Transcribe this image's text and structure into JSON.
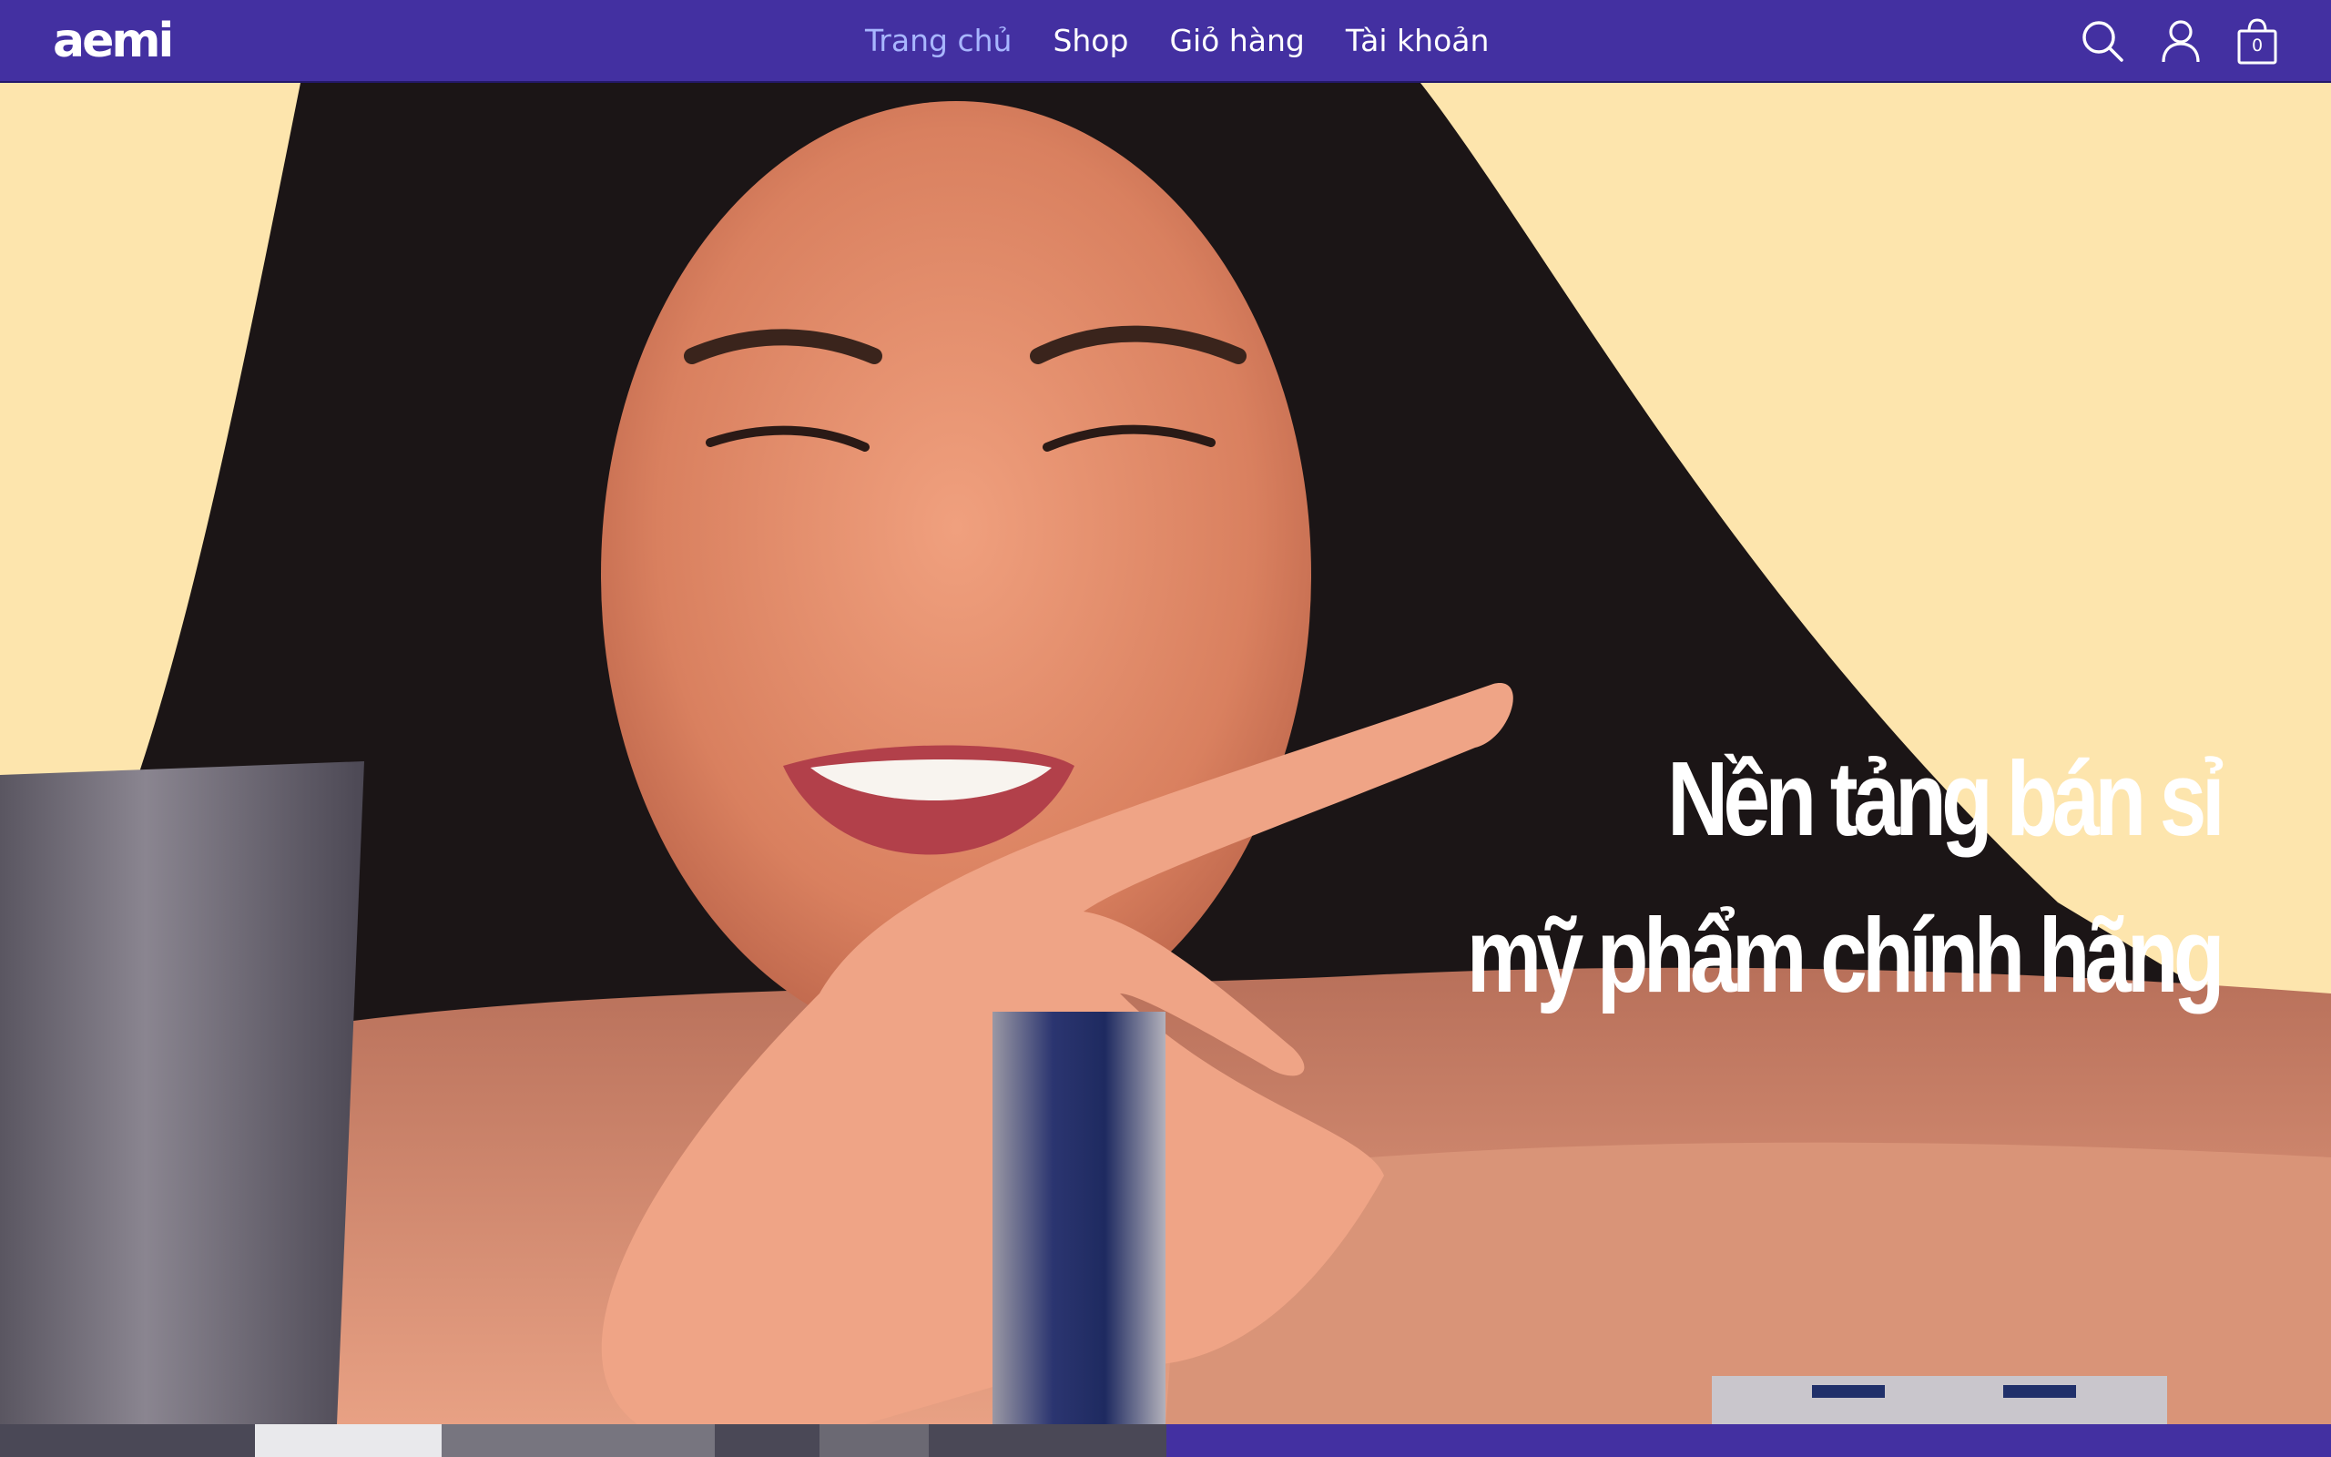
{
  "brand": {
    "logo_text": "aemi"
  },
  "nav": {
    "items": [
      {
        "label": "Trang chủ",
        "active": true
      },
      {
        "label": "Shop",
        "active": false
      },
      {
        "label": "Giỏ hàng",
        "active": false
      },
      {
        "label": "Tài khoản",
        "active": false
      }
    ]
  },
  "header_actions": {
    "search_icon": "search-icon",
    "account_icon": "user-icon",
    "cart_icon": "shopping-bag-icon",
    "cart_count": "0"
  },
  "hero": {
    "title_line1": "Nền tảng bán sỉ",
    "title_line2": "mỹ phẩm chính hãng"
  },
  "colors": {
    "header_bg": "#4330a1",
    "nav_active": "#a8b6ff",
    "hero_bg": "#fde5ad",
    "hero_text": "#ffffff"
  }
}
